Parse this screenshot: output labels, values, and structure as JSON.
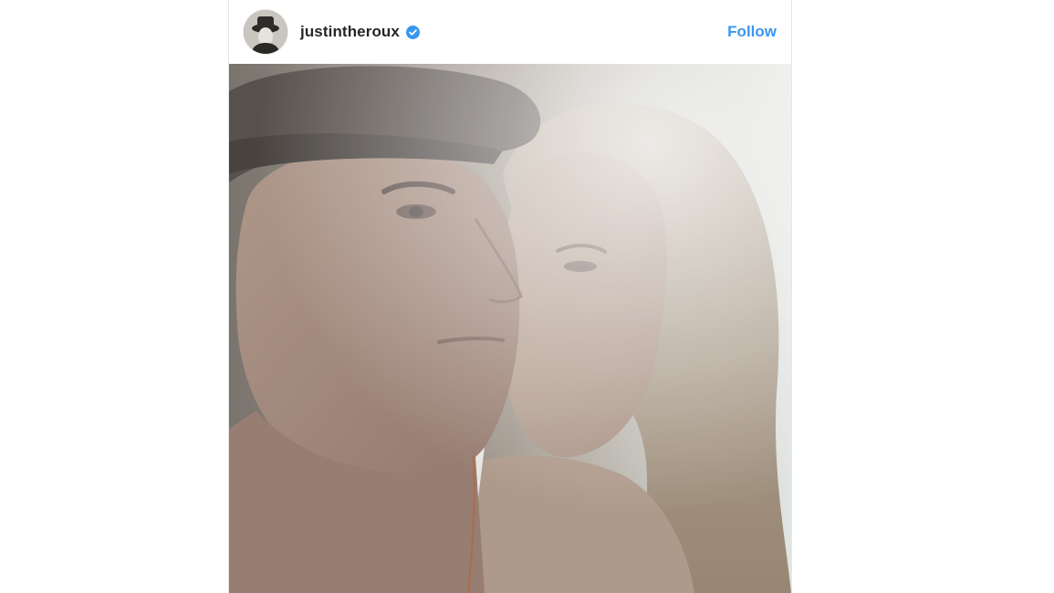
{
  "post": {
    "username": "justintheroux",
    "follow_label": "Follow",
    "avatar_icon": "user-avatar",
    "verified_icon": "verified-badge-icon",
    "verified_color": "#3897f0",
    "follow_color": "#3897f0"
  }
}
